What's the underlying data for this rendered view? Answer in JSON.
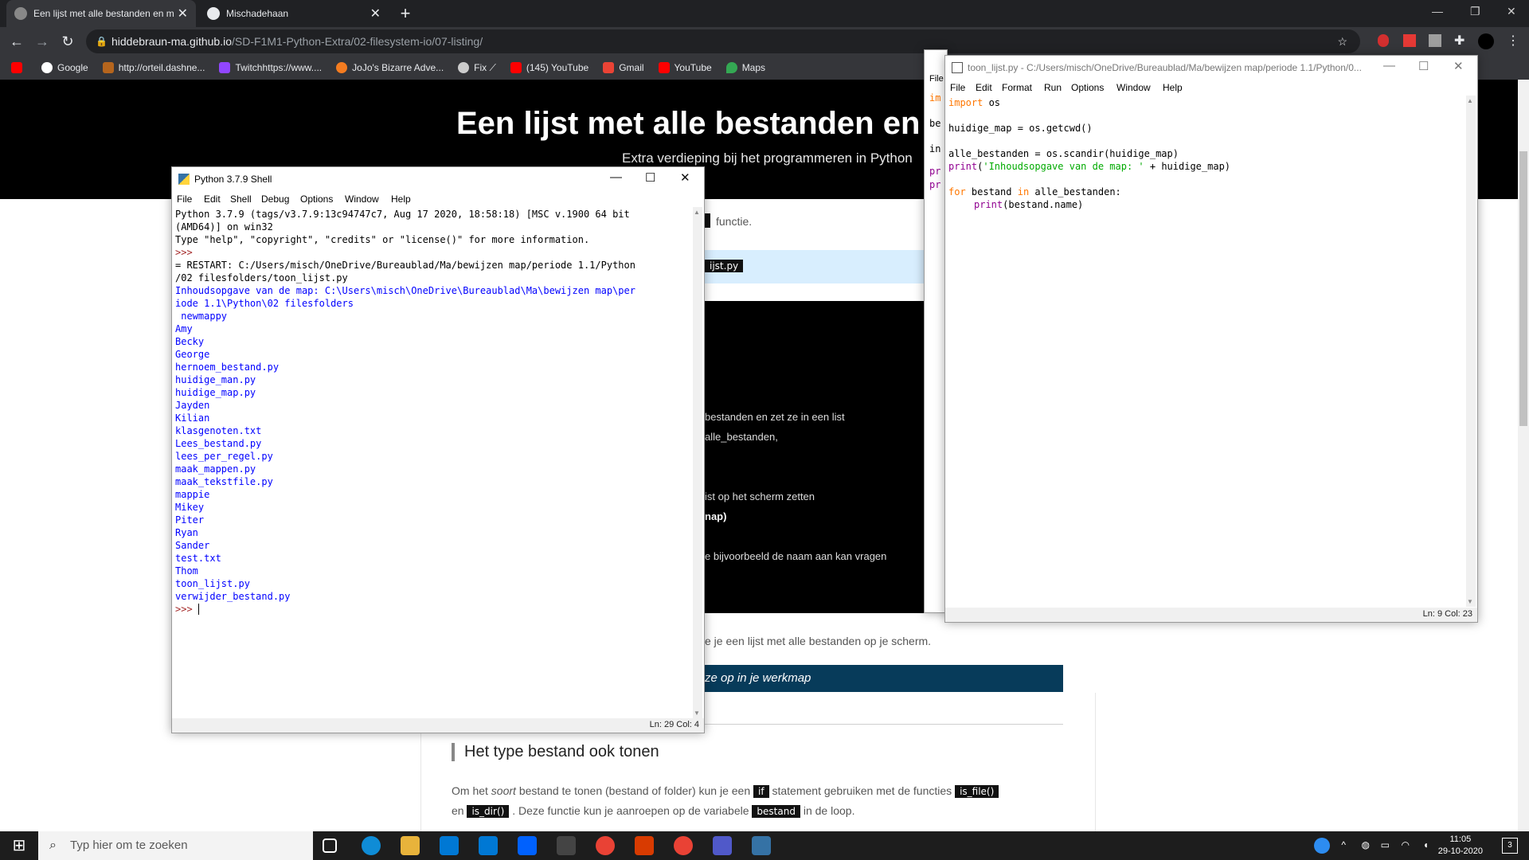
{
  "browser": {
    "tabs": [
      {
        "title": "Een lijst met alle bestanden en m",
        "close": "✕"
      },
      {
        "title": "Mischadehaan",
        "close": "✕"
      }
    ],
    "new_tab": "+",
    "url_host": "hiddebraun-ma.github.io",
    "url_path": "/SD-F1M1-Python-Extra/02-filesystem-io/07-listing/",
    "bookmarks": [
      {
        "label": "Google",
        "color": "#ffffff"
      },
      {
        "label": "http://orteil.dashne...",
        "color": "#b5651d"
      },
      {
        "label": "Twitchhttps://www....",
        "color": "#9146ff"
      },
      {
        "label": "JoJo's Bizarre Adve...",
        "color": "#f47c20"
      },
      {
        "label": "Fix ⟋",
        "color": "#cccccc"
      },
      {
        "label": "(145) YouTube",
        "color": "#ff0000"
      },
      {
        "label": "Gmail",
        "color": "#ea4335"
      },
      {
        "label": "YouTube",
        "color": "#ff0000"
      },
      {
        "label": "Maps",
        "color": "#34a853"
      }
    ]
  },
  "webpage": {
    "hero_title": "Een lijst met alle bestanden en ma",
    "hero_subtitle": "Extra verdieping bij het programmeren in Python",
    "frag_functie": "functie.",
    "frag_jst": "ijst.py",
    "code_lines": [
      "bestanden en zet ze in een list",
      "alle_bestanden,",
      "ist op het scherm zetten",
      "nap)",
      "e bijvoorbeeld de naam aan kan vragen"
    ],
    "frag_scherm": "e je een lijst met alle bestanden op je scherm.",
    "blue_bar": "ze op in je werkmap",
    "section_heading": "Het type bestand ook tonen",
    "para1_a": "Om het",
    "para1_soort": "soort",
    "para1_b": "bestand te tonen (bestand of folder) kun je een",
    "pill_if": "if",
    "para1_c": "statement gebruiken met de functies",
    "pill_is_file": "is_file()",
    "para2_en": "en",
    "pill_is_dir": "is_dir()",
    "para2_b": ". Deze functie kun je aanroepen op de variabele",
    "pill_bestand": "bestand",
    "para2_c": "in de loop."
  },
  "shell": {
    "title": "Python 3.7.9 Shell",
    "menu": [
      "File",
      "Edit",
      "Shell",
      "Debug",
      "Options",
      "Window",
      "Help"
    ],
    "banner1": "Python 3.7.9 (tags/v3.7.9:13c94747c7, Aug 17 2020, 18:58:18) [MSC v.1900 64 bit",
    "banner2": "(AMD64)] on win32",
    "banner3": "Type \"help\", \"copyright\", \"credits\" or \"license()\" for more information.",
    "prompt": ">>>",
    "restart1": "= RESTART: C:/Users/misch/OneDrive/Bureaublad/Ma/bewijzen map/periode 1.1/Python",
    "restart2": "/02 filesfolders/toon_lijst.py",
    "output_header1": "Inhoudsopgave van de map: C:\\Users\\misch\\OneDrive\\Bureaublad\\Ma\\bewijzen map\\per",
    "output_header2": "iode 1.1\\Python\\02 filesfolders",
    "files": [
      " newmappy",
      "Amy",
      "Becky",
      "George",
      "hernoem_bestand.py",
      "huidige_man.py",
      "huidige_map.py",
      "Jayden",
      "Kilian",
      "klasgenoten.txt",
      "Lees_bestand.py",
      "lees_per_regel.py",
      "maak_mappen.py",
      "maak_tekstfile.py",
      "mappie",
      "Mikey",
      "Piter",
      "Ryan",
      "Sander",
      "test.txt",
      "Thom",
      "toon_lijst.py",
      "verwijder_bestand.py"
    ],
    "status": "Ln: 29   Col: 4"
  },
  "editor": {
    "title": "toon_lijst.py - C:/Users/misch/OneDrive/Bureaublad/Ma/bewijzen map/periode 1.1/Python/0...",
    "menu": [
      "File",
      "Edit",
      "Format",
      "Run",
      "Options",
      "Window",
      "Help"
    ],
    "code": {
      "l1_kw": "import",
      "l1_rest": " os",
      "l3": "huidige_map = os.getcwd()",
      "l5": "alle_bestanden = os.scandir(huidige_map)",
      "l6_bi": "print",
      "l6_a": "(",
      "l6_st": "'Inhoudsopgave van de map: '",
      "l6_b": " + huidige_map)",
      "l8_kw1": "for",
      "l8_a": " bestand ",
      "l8_kw2": "in",
      "l8_b": " alle_bestanden:",
      "l9_bi": "print",
      "l9_b": "(bestand.name)"
    },
    "status": "Ln: 9   Col: 23"
  },
  "behind_window": {
    "lines": [
      "File",
      "im",
      "be",
      "in",
      "pr",
      "pr"
    ]
  },
  "taskbar": {
    "search_placeholder": "Typ hier om te zoeken",
    "time": "11:05",
    "date": "29-10-2020",
    "notification_count": "3"
  }
}
